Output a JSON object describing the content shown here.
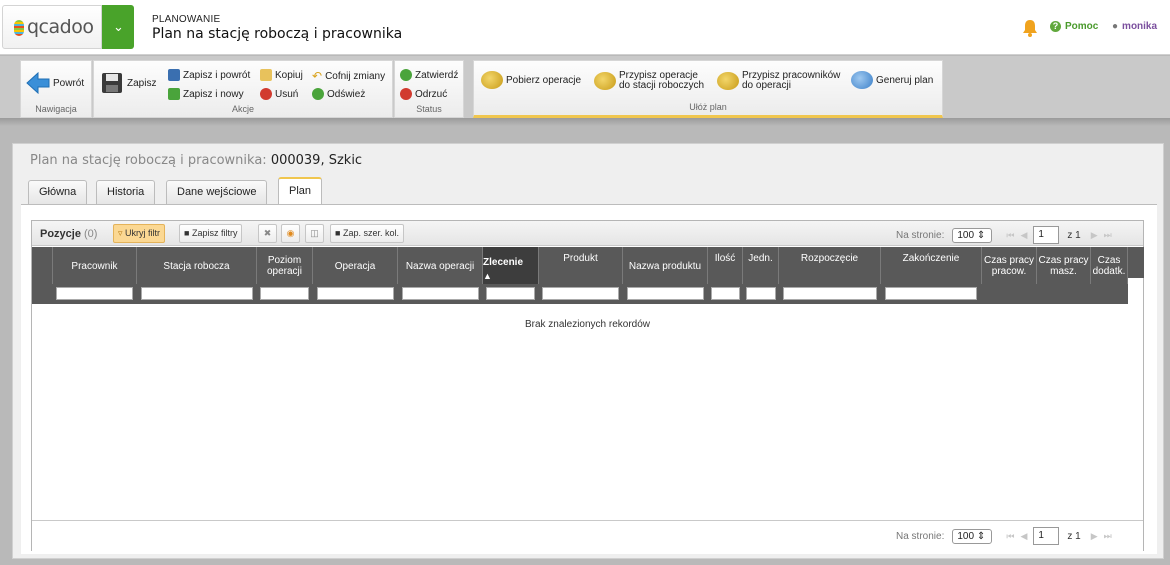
{
  "header": {
    "logo": "qcadoo",
    "category": "PLANOWANIE",
    "title": "Plan na stację roboczą i pracownika",
    "help": "Pomoc",
    "user": "monika"
  },
  "ribbon": {
    "nav": {
      "back": "Powrót",
      "group": "Nawigacja"
    },
    "actions": {
      "save": "Zapisz",
      "save_back": "Zapisz i powrót",
      "save_new": "Zapisz i nowy",
      "copy": "Kopiuj",
      "delete": "Usuń",
      "undo": "Cofnij zmiany",
      "refresh": "Odśwież",
      "group": "Akcje"
    },
    "status": {
      "approve": "Zatwierdź",
      "reject": "Odrzuć",
      "group": "Status"
    },
    "plan": {
      "fetch_ops": "Pobierz operacje",
      "assign_ops_1": "Przypisz operacje",
      "assign_ops_2": "do stacji roboczych",
      "assign_workers_1": "Przypisz pracowników",
      "assign_workers_2": "do operacji",
      "generate": "Generuj plan",
      "group": "Ułóż plan"
    }
  },
  "panel": {
    "title_prefix": "Plan na stację roboczą i pracownika:",
    "title_value": "000039, Szkic",
    "tabs": [
      "Główna",
      "Historia",
      "Dane wejściowe",
      "Plan"
    ],
    "active_tab": "Plan"
  },
  "grid": {
    "caption": "Pozycje",
    "count": "(0)",
    "toolbar": {
      "hide_filter": "Ukryj filtr",
      "save_filters": "Zapisz filtry",
      "save_widths": "Zap. szer. kol."
    },
    "pager": {
      "per_page_label": "Na stronie:",
      "per_page": "100",
      "page": "1",
      "of": "z 1"
    },
    "columns": [
      "Pracownik",
      "Stacja robocza",
      "Poziom operacji",
      "Operacja",
      "Nazwa operacji",
      "Zlecenie",
      "Produkt",
      "Nazwa produktu",
      "Ilość",
      "Jedn.",
      "Rozpoczęcie",
      "Zakończenie",
      "Czas pracy pracow.",
      "Czas pracy masz.",
      "Czas dodatk."
    ],
    "sorted_column": "Zlecenie",
    "empty_message": "Brak znalezionych rekordów"
  },
  "colors": {
    "accent_green": "#49a32a",
    "grid_header": "#595959",
    "active_tab_border": "#f0c64e",
    "user_name": "#7b4f9e"
  }
}
